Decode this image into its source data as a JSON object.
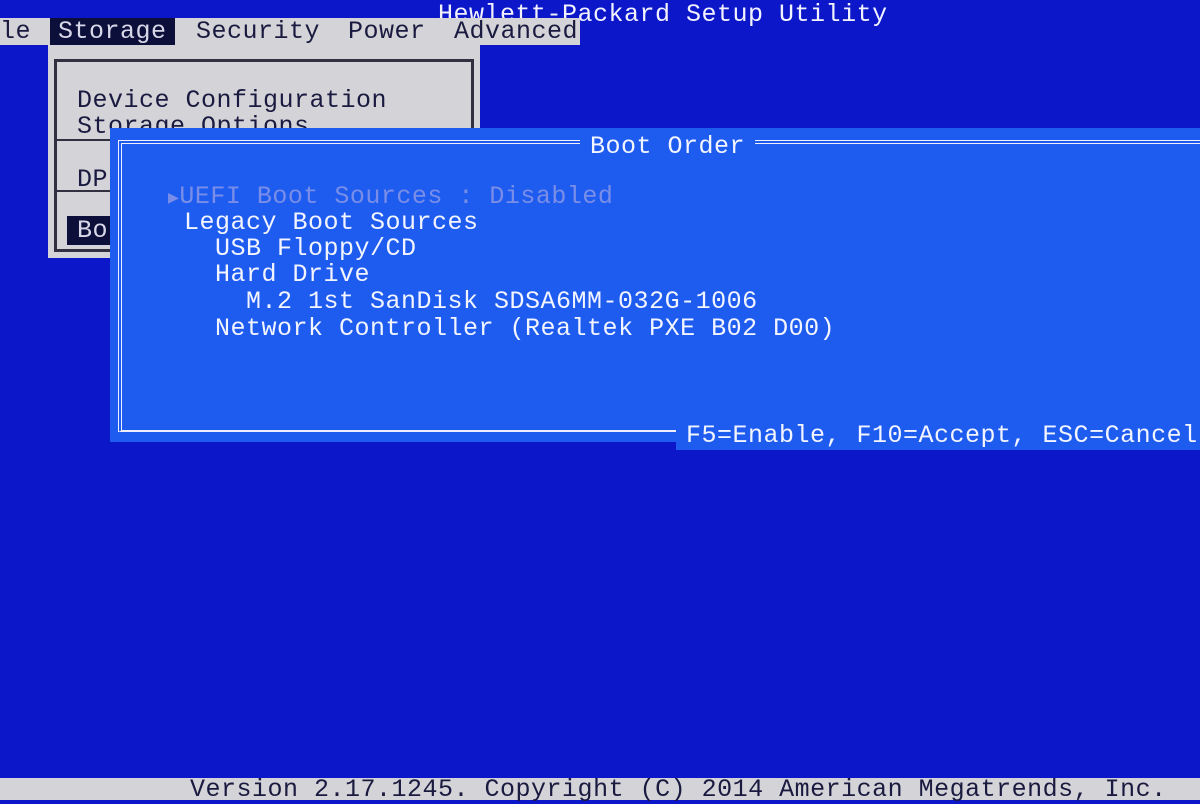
{
  "window": {
    "title": "Hewlett-Packard Setup Utility"
  },
  "menu": [
    {
      "label": "le",
      "selected": false
    },
    {
      "label": "Storage",
      "selected": true
    },
    {
      "label": "Security",
      "selected": false
    },
    {
      "label": "Power",
      "selected": false
    },
    {
      "label": "Advanced",
      "selected": false
    }
  ],
  "storage_menu": {
    "items": [
      "Device Configuration",
      "Storage Options",
      "DP",
      "Bo"
    ]
  },
  "dialog": {
    "title": "Boot Order",
    "rows": [
      {
        "label": "UEFI Boot Sources : Disabled",
        "disabled": true,
        "marker": "triangle-right-icon"
      },
      {
        "label": "Legacy Boot Sources"
      },
      {
        "label": "USB Floppy/CD"
      },
      {
        "label": "Hard Drive"
      },
      {
        "label": "M.2 1st SanDisk SDSA6MM-032G-1006"
      },
      {
        "label": "Network Controller (Realtek PXE B02 D00)"
      }
    ],
    "footer": "F5=Enable, F10=Accept, ESC=Cancel"
  },
  "status_bar": {
    "text": "Version 2.17.1245. Copyright (C) 2014 American Megatrends, Inc."
  },
  "colors": {
    "background": "#0b17c9",
    "dialog": "#1e5cf0",
    "menu": "#d4d4d8",
    "highlight": "#0c0f3a"
  }
}
